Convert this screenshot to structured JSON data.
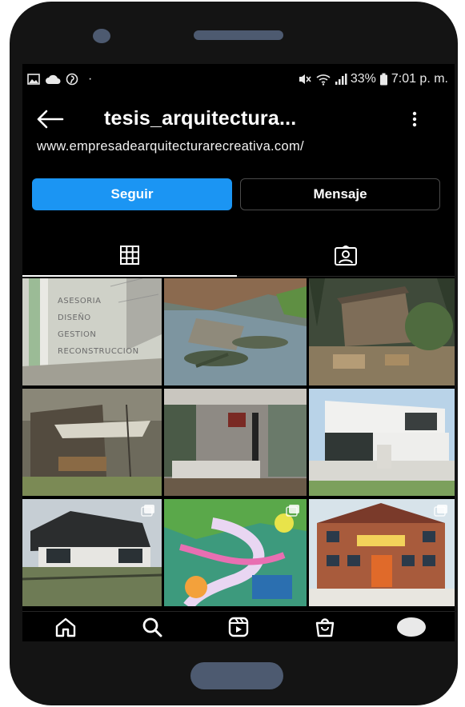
{
  "status_bar": {
    "battery": "33%",
    "time": "7:01 p. m.",
    "dot": "·"
  },
  "header": {
    "username": "tesis_arquitectura..."
  },
  "profile": {
    "website": "www.empresadearquitecturarecreativa.com/"
  },
  "actions": {
    "follow_label": "Seguir",
    "message_label": "Mensaje"
  },
  "tabs": [
    {
      "icon": "grid-icon",
      "active": true
    },
    {
      "icon": "tagged-person-icon",
      "active": false
    }
  ],
  "posts": [
    {
      "description_lines": [
        "ASESORIA",
        "DISEÑO",
        "GESTION",
        "RECONSTRUCCION"
      ]
    },
    {
      "multi": false
    },
    {
      "multi": false
    },
    {
      "multi": false
    },
    {
      "multi": false
    },
    {
      "multi": false
    },
    {
      "multi": true
    },
    {
      "multi": true
    },
    {
      "multi": true
    }
  ],
  "bottom_nav": [
    {
      "icon": "home-icon"
    },
    {
      "icon": "search-icon"
    },
    {
      "icon": "reels-icon"
    },
    {
      "icon": "shop-icon"
    },
    {
      "icon": "profile-avatar"
    }
  ],
  "colors": {
    "accent": "#1b95f3",
    "background": "#000000",
    "phone_frame": "#141414",
    "phone_details": "#4d5a70"
  }
}
